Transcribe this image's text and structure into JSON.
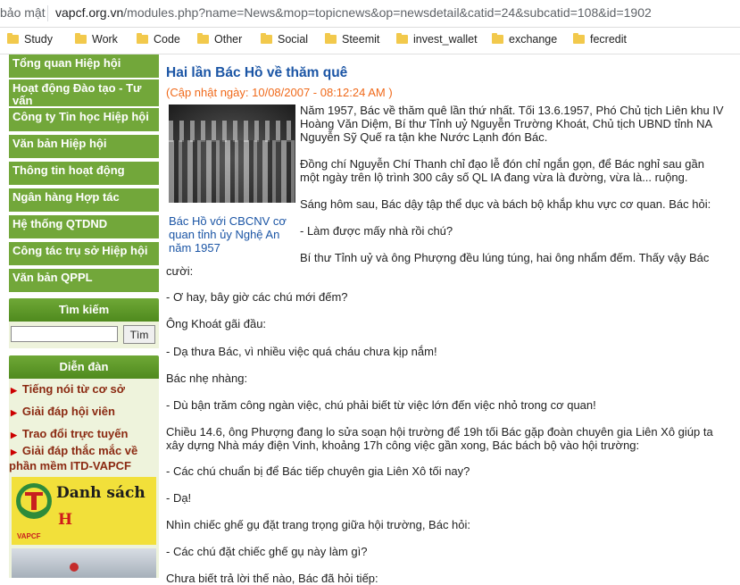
{
  "browser": {
    "security_label": "bảo mật",
    "url_host": "vapcf.org.vn",
    "url_path": "/modules.php?name=News&mop=topicnews&op=newsdetail&catid=24&subcatid=108&id=1902",
    "bookmarks": [
      "Study",
      "Work",
      "Code",
      "Other",
      "Social",
      "Steemit",
      "invest_wallet",
      "exchange",
      "fecredit"
    ]
  },
  "sidebar": {
    "menu": [
      {
        "label_lines": [
          "Tổng quan Hiệp hội"
        ]
      },
      {
        "label_lines": [
          "Hoạt động Đào tạo - Tư",
          "vấn"
        ]
      },
      {
        "label_lines": [
          "Công ty Tin học Hiệp hội"
        ]
      },
      {
        "label_lines": [
          "Văn bản Hiệp hội"
        ]
      },
      {
        "label_lines": [
          "Thông tin hoạt động"
        ]
      },
      {
        "label_lines": [
          "Ngân hàng Hợp tác"
        ]
      },
      {
        "label_lines": [
          "Hệ thống QTDND"
        ]
      },
      {
        "label_lines": [
          "Công tác trụ sở Hiệp hội"
        ]
      },
      {
        "label_lines": [
          "Văn bản QPPL"
        ]
      }
    ],
    "search": {
      "title": "Tìm kiếm",
      "value": "",
      "button": "Tìm"
    },
    "forum": {
      "title": "Diễn đàn",
      "links": [
        {
          "lines": [
            "Tiếng nói từ cơ sở"
          ]
        },
        {
          "lines": [
            "Giải đáp hội viên"
          ]
        },
        {
          "lines": [
            "Trao đổi trực tuyến"
          ]
        },
        {
          "lines": [
            "Giải đáp thắc mắc về",
            "phần mềm ITD-VAPCF"
          ]
        }
      ]
    },
    "banner": {
      "line1": "Danh sách",
      "line2": "H",
      "logo_text": "VAPCF"
    }
  },
  "article": {
    "title": "Hai lần Bác Hồ về thăm quê",
    "updated": "(Cập nhật ngày: 10/08/2007 - 08:12:24 AM )",
    "caption_lines": [
      "Bác Hồ với CBCNV cơ",
      "quan tỉnh ủy Nghệ An",
      "năm 1957"
    ],
    "paragraphs": [
      {
        "lines": [
          "Năm 1957, Bác về thăm quê lần thứ nhất. Tối 13.6.1957, Phó Chủ tịch Liên khu IV",
          "Hoàng Văn Diệm, Bí thư Tỉnh uỷ Nguyễn Trường Khoát, Chủ tịch UBND tỉnh NA",
          "Nguyễn Sỹ Quế ra tận khe Nước Lạnh đón Bác."
        ]
      },
      {
        "lines": [
          "Đồng chí Nguyễn Chí Thanh chỉ đạo lễ đón chỉ ngắn gọn, để Bác nghỉ sau gần",
          "một ngày trên lộ trình 300 cây số QL IA đang vừa là đường, vừa là... ruộng."
        ]
      },
      {
        "lines": [
          "Sáng hôm sau, Bác dậy tập thể dục và bách bộ khắp khu vực cơ quan. Bác hỏi:"
        ]
      },
      {
        "lines": [
          "- Làm được mấy nhà rồi chú?"
        ]
      },
      {
        "lines": [
          "Bí thư Tỉnh uỷ và ông Phượng đều lúng túng, hai ông nhẩm đếm. Thấy vậy Bác"
        ]
      },
      {
        "lines": [
          "cười:"
        ]
      },
      {
        "lines": [
          "- Ơ hay, bây giờ các chú mới đếm?"
        ]
      },
      {
        "lines": [
          "Ông Khoát gãi đầu:"
        ]
      },
      {
        "lines": [
          "- Dạ thưa Bác, vì nhiều việc quá cháu chưa kịp nắm!"
        ]
      },
      {
        "lines": [
          "Bác nhẹ nhàng:"
        ]
      },
      {
        "lines": [
          "- Dù bận trăm công ngàn việc, chú phải biết từ việc lớn đến việc nhỏ trong cơ quan!"
        ]
      },
      {
        "lines": [
          "Chiều 14.6, ông Phượng đang lo sửa soạn hội trường để 19h tối Bác gặp đoàn chuyên gia Liên Xô giúp ta",
          "xây dựng Nhà máy điện Vinh, khoảng 17h công việc gần xong, Bác bách bộ vào hội trường:"
        ]
      },
      {
        "lines": [
          "- Các chú chuẩn bị để Bác tiếp chuyên gia Liên Xô tối nay?"
        ]
      },
      {
        "lines": [
          "- Dạ!"
        ]
      },
      {
        "lines": [
          "Nhìn chiếc ghế gụ đặt trang trọng giữa hội trường, Bác hỏi:"
        ]
      },
      {
        "lines": [
          "- Các chú đặt chiếc ghế gụ này làm gì?"
        ]
      },
      {
        "lines": [
          "Chưa biết trả lời thế nào, Bác đã hỏi tiếp:"
        ]
      }
    ]
  }
}
